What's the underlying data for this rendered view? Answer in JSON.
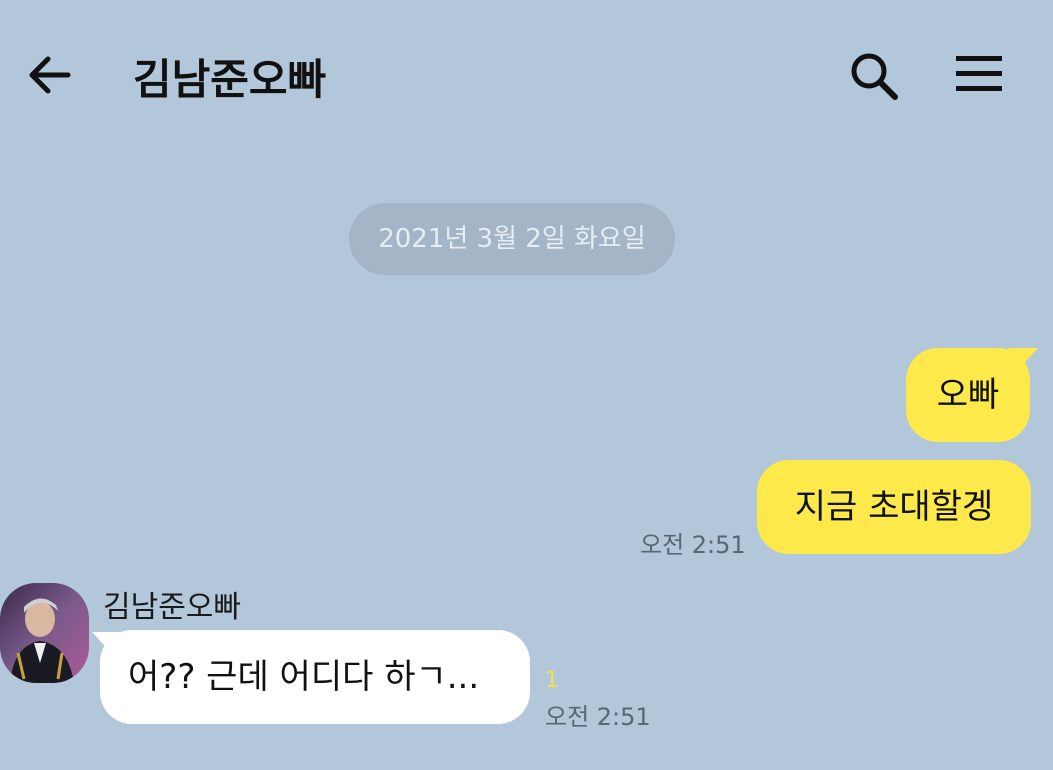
{
  "header": {
    "title": "김남준오빠",
    "back_icon": "arrow-left-icon",
    "search_icon": "search-icon",
    "menu_icon": "hamburger-menu-icon"
  },
  "date_divider": "2021년 3월 2일 화요일",
  "messages": [
    {
      "from": "me",
      "text": "오빠"
    },
    {
      "from": "me",
      "text": "지금 초대할겡",
      "time": "오전 2:51"
    },
    {
      "from": "them",
      "sender": "김남준오빠",
      "text": "어?? 근데 어디다 하ㄱ...",
      "unread": "1",
      "time": "오전 2:51"
    }
  ],
  "colors": {
    "background": "#b2c7da",
    "my_bubble": "#fee94a",
    "their_bubble": "#ffffff",
    "date_pill": "#a3b5c6",
    "unread": "#f0e24a"
  }
}
